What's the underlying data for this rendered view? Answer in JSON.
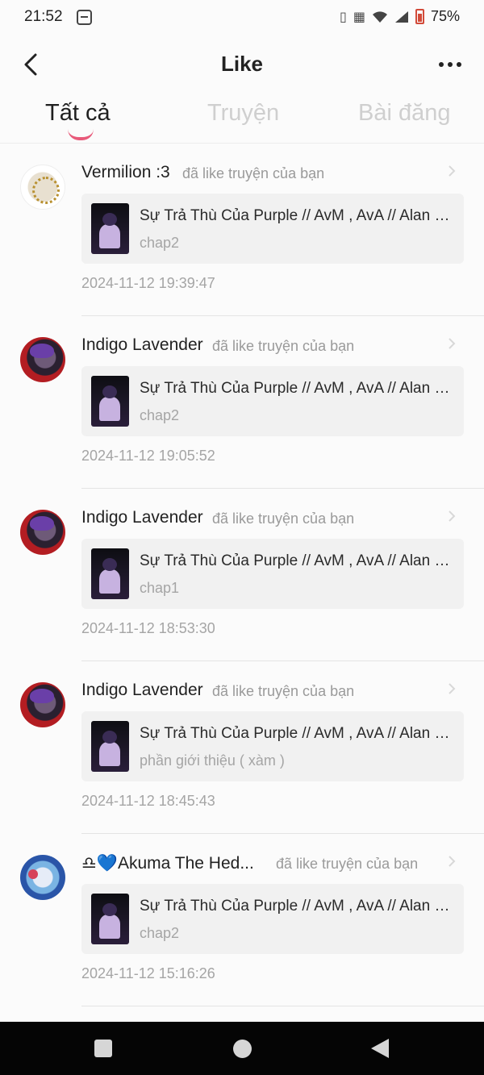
{
  "status_bar": {
    "time": "21:52",
    "battery": "75%"
  },
  "header": {
    "title": "Like"
  },
  "tabs": [
    {
      "label": "Tất cả",
      "active": true
    },
    {
      "label": "Truyện",
      "active": false
    },
    {
      "label": "Bài đăng",
      "active": false
    }
  ],
  "items": [
    {
      "user": "Vermilion :3",
      "action": "đã like truyện của bạn",
      "story_title": "Sự Trả Thù Của Purple // AvM , AvA // Alan Becker",
      "chapter": "chap2",
      "time": "2024-11-12 19:39:47"
    },
    {
      "user": "Indigo Lavender",
      "action": "đã like truyện của bạn",
      "story_title": "Sự Trả Thù Của Purple // AvM , AvA // Alan Becker",
      "chapter": "chap2",
      "time": "2024-11-12 19:05:52"
    },
    {
      "user": "Indigo Lavender",
      "action": "đã like truyện của bạn",
      "story_title": "Sự Trả Thù Của Purple // AvM , AvA // Alan Becker",
      "chapter": "chap1",
      "time": "2024-11-12 18:53:30"
    },
    {
      "user": "Indigo Lavender",
      "action": "đã like truyện của bạn",
      "story_title": "Sự Trả Thù Của Purple // AvM , AvA // Alan Becker",
      "chapter": "phần giới thiệu ( xàm )",
      "time": "2024-11-12 18:45:43"
    },
    {
      "user": "♎💙Akuma The Hed...",
      "action": "đã like truyện của bạn",
      "story_title": "Sự Trả Thù Của Purple // AvM , AvA // Alan Becker",
      "chapter": "chap2",
      "time": "2024-11-12 15:16:26"
    }
  ],
  "colors": {
    "accent": "#e85a7a",
    "card_bg": "#f1f1f1",
    "muted_text": "#a5a5a5"
  },
  "icons": [
    "back-arrow-icon",
    "more-dots-icon",
    "chevron-right-icon",
    "email-icon",
    "vibrate-icon",
    "wifi-icon",
    "signal-icon",
    "battery-icon"
  ]
}
